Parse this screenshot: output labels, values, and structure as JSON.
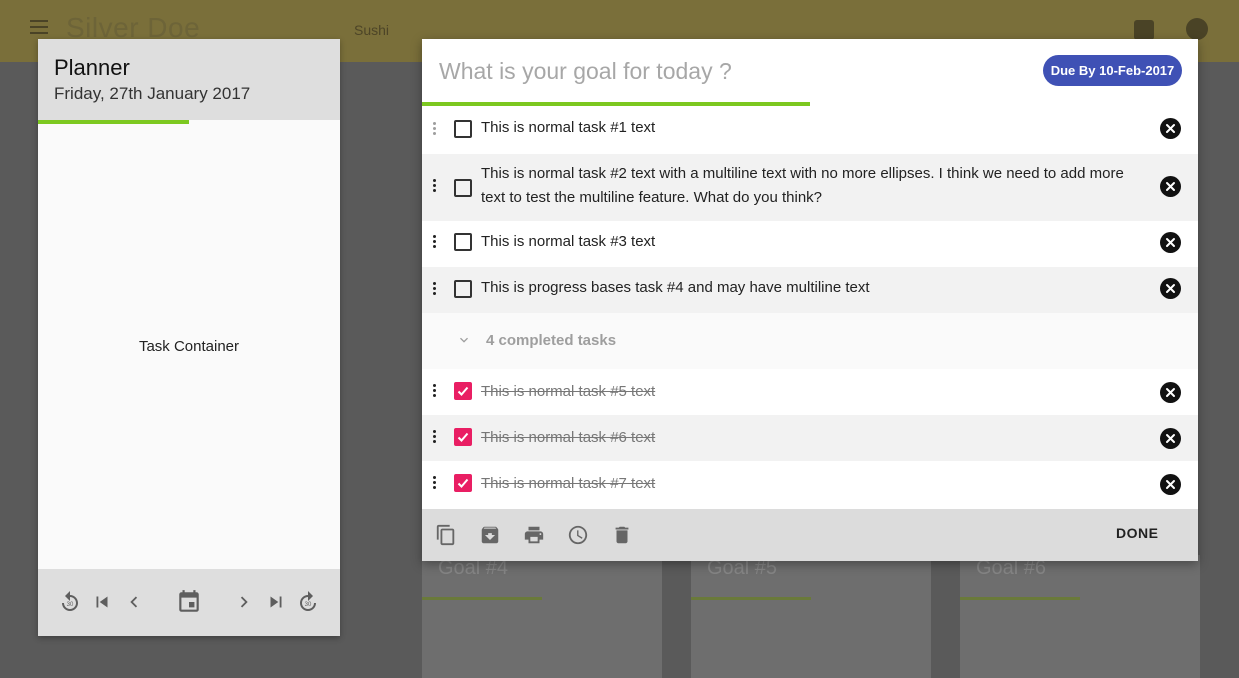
{
  "app": {
    "brand": "Silver Doe",
    "user": "Sushi"
  },
  "background_goals": [
    "Goal #4",
    "Goal #5",
    "Goal #6"
  ],
  "planner": {
    "title": "Planner",
    "date": "Friday, 27th January 2017",
    "progress_pct": 50,
    "body_label": "Task Container",
    "toolbar": [
      "replay-30-icon",
      "skip-previous-icon",
      "chevron-left-icon",
      "calendar-icon",
      "chevron-right-icon",
      "skip-next-icon",
      "forward-30-icon"
    ]
  },
  "goal": {
    "placeholder": "What is your goal for today ?",
    "due_badge": "Due By 10-Feb-2017",
    "progress_pct": 50,
    "tasks": [
      {
        "text": "This is normal task #1 text",
        "checked": false
      },
      {
        "text": "This is normal task #2 text with a multiline text with no more ellipses. I think we need to add more text to test the multiline feature. What do you think?",
        "checked": false
      },
      {
        "text": "This is normal task #3 text",
        "checked": false
      },
      {
        "text": "This is progress bases task #4 and may have multiline text",
        "checked": false
      }
    ],
    "completed_label": "4 completed tasks",
    "completed_tasks": [
      {
        "text": "This is normal task #5 text",
        "checked": true
      },
      {
        "text": "This is normal task #6 text",
        "checked": true
      },
      {
        "text": "This is normal task #7 text",
        "checked": true
      }
    ],
    "toolbar": [
      "copy-icon",
      "archive-icon",
      "print-icon",
      "clock-icon",
      "delete-icon"
    ],
    "done_label": "DONE"
  },
  "colors": {
    "accent_green": "#7cc820",
    "badge_blue": "#3f51b5",
    "check_pink": "#e91e63"
  }
}
